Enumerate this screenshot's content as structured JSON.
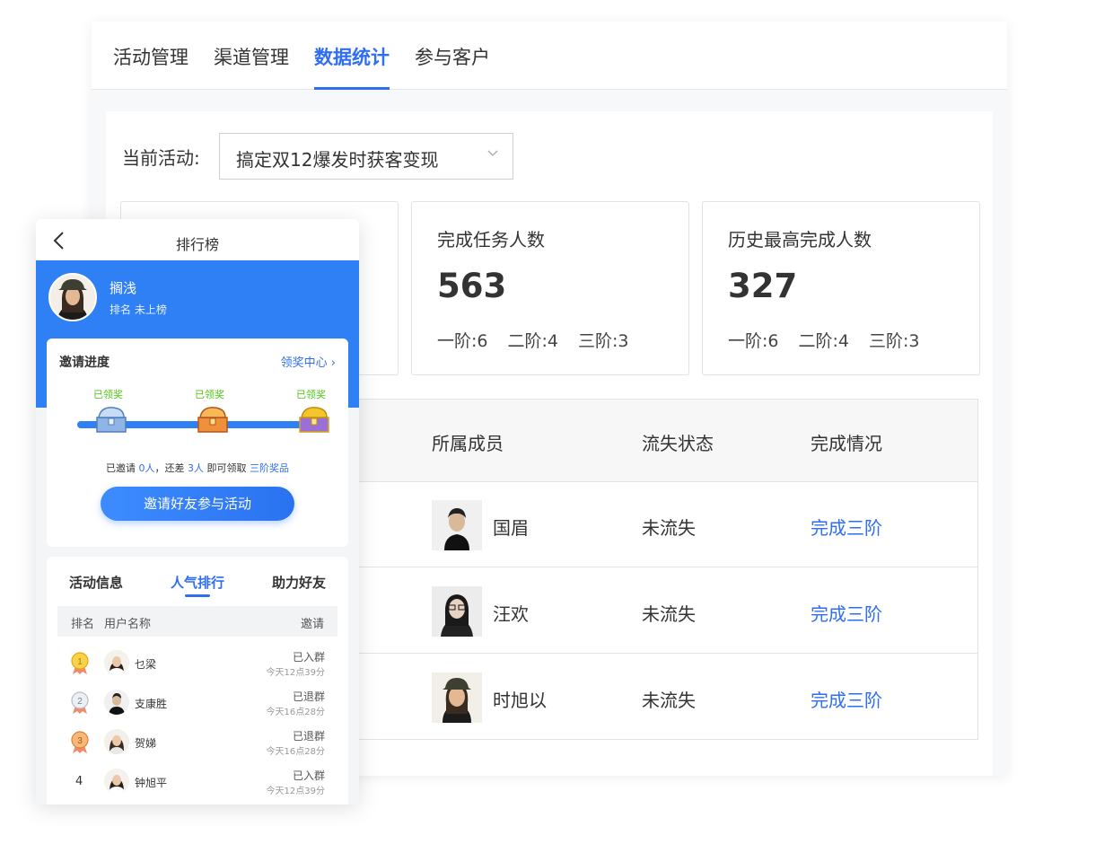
{
  "dashboard": {
    "tabs": [
      {
        "label": "活动管理"
      },
      {
        "label": "渠道管理"
      },
      {
        "label": "数据统计"
      },
      {
        "label": "参与客户"
      }
    ],
    "current_activity_label": "当前活动:",
    "current_activity_value": "搞定双12爆发时获客变现",
    "cards": [
      {
        "title": "完成任务人数",
        "value": "563",
        "tiers": [
          "一阶:6",
          "二阶:4",
          "三阶:3"
        ]
      },
      {
        "title": "历史最高完成人数",
        "value": "327",
        "tiers": [
          "一阶:6",
          "二阶:4",
          "三阶:3"
        ]
      }
    ],
    "table": {
      "headers": [
        "所属成员",
        "流失状态",
        "完成情况"
      ],
      "rows": [
        {
          "member": "国眉",
          "status": "未流失",
          "completion": "完成三阶"
        },
        {
          "member": "汪欢",
          "status": "未流失",
          "completion": "完成三阶"
        },
        {
          "member": "时旭以",
          "status": "未流失",
          "completion": "完成三阶"
        }
      ]
    }
  },
  "mobile": {
    "title": "排行榜",
    "user_name": "搁浅",
    "user_rank": "排名 未上榜",
    "invite": {
      "title": "邀请进度",
      "link": "领奖中心 ›",
      "milestones": [
        "已领奖",
        "已领奖",
        "已领奖"
      ],
      "status_prefix": "已邀请",
      "status_invited": "0人",
      "status_mid": "，还差",
      "status_remaining": "3人",
      "status_mid2": "即可领取",
      "status_reward": "三阶奖品",
      "button": "邀请好友参与活动"
    },
    "tabs": [
      {
        "label": "活动信息"
      },
      {
        "label": "人气排行"
      },
      {
        "label": "助力好友"
      }
    ],
    "rank_headers": {
      "rank": "排名",
      "name": "用户名称",
      "invite": "邀请"
    },
    "rank_rows": [
      {
        "rank": "1",
        "name": "乜梁",
        "status": "已入群",
        "time": "今天12点39分"
      },
      {
        "rank": "2",
        "name": "支康胜",
        "status": "已退群",
        "time": "今天16点28分"
      },
      {
        "rank": "3",
        "name": "贺娣",
        "status": "已退群",
        "time": "今天16点28分"
      },
      {
        "rank": "4",
        "name": "钟旭平",
        "status": "已入群",
        "time": "今天12点39分"
      }
    ]
  },
  "colors": {
    "accent": "#2f6ef0",
    "banner": "#2f7ff5",
    "success": "#52c41a"
  }
}
